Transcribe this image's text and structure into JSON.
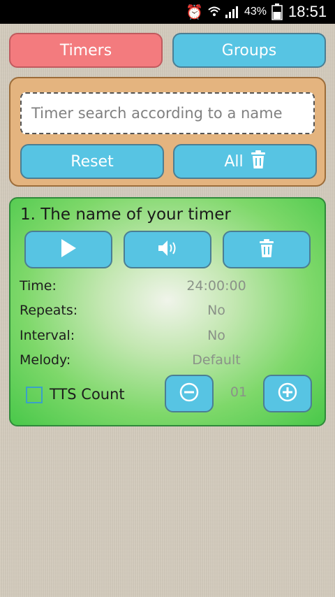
{
  "status_bar": {
    "battery_percent": "43%",
    "time": "18:51",
    "icons": [
      "alarm-icon",
      "wifi-icon",
      "signal-icon",
      "battery-icon"
    ]
  },
  "tabs": {
    "timers": "Timers",
    "groups": "Groups"
  },
  "search": {
    "placeholder": "Timer search according to a name",
    "reset_label": "Reset",
    "all_label": "All"
  },
  "timer": {
    "title": "1. The name of your timer",
    "fields": {
      "time_label": "Time:",
      "time_value": "24:00:00",
      "repeats_label": "Repeats:",
      "repeats_value": "No",
      "interval_label": "Interval:",
      "interval_value": "No",
      "melody_label": "Melody:",
      "melody_value": "Default"
    },
    "tts_label": "TTS Count",
    "tts_checked": false,
    "count_value": "01"
  },
  "colors": {
    "blue_button": "#57c4e3",
    "red_tab": "#f37b7e",
    "orange_panel": "#e4b47f",
    "green_card": "#49c84a"
  }
}
